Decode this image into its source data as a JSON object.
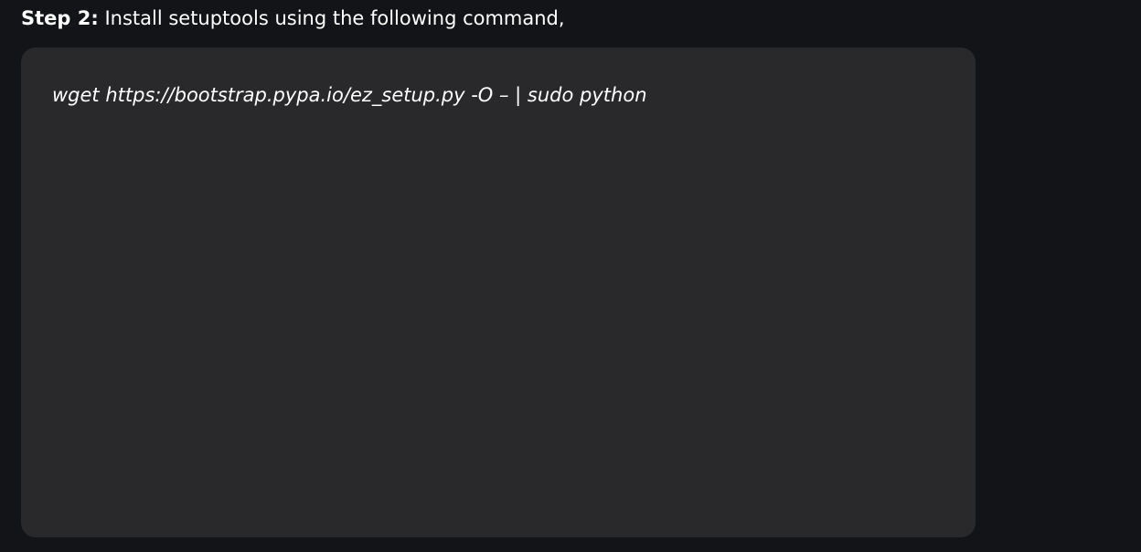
{
  "step": {
    "label": "Step 2:",
    "text": " Install setuptools using the following command,"
  },
  "code_block": {
    "command": "wget https://bootstrap.pypa.io/ez_setup.py -O – | sudo python"
  }
}
